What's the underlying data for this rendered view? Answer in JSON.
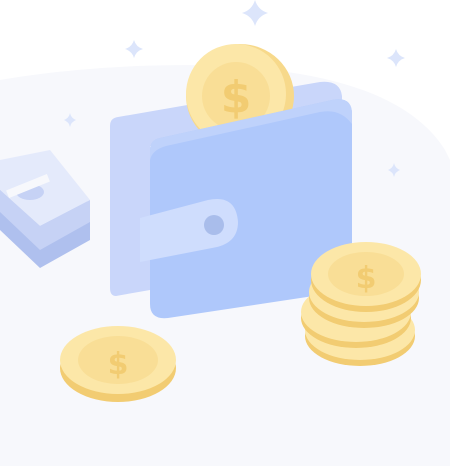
{
  "illustration": {
    "subject": "wallet-with-coins-and-cash",
    "icons": [
      "sparkle-icon",
      "wallet-icon",
      "coin-icon",
      "cash-stack-icon",
      "coin-stack-icon"
    ],
    "colors": {
      "background_blob": "#F7F8FC",
      "sparkle": "#DCE5FB",
      "wallet_back": "#C9D6FA",
      "wallet_front": "#AFC8FB",
      "wallet_shade": "#BFD2FB",
      "wallet_clasp": "#CFDDFD",
      "wallet_button": "#A9BDEB",
      "coin_face": "#FCE7A8",
      "coin_rim": "#F7D98B",
      "coin_symbol": "#F2CC72",
      "cash_light": "#E4EAFB",
      "cash_mid": "#C6D2F5",
      "cash_dark": "#AFC0EE"
    }
  }
}
